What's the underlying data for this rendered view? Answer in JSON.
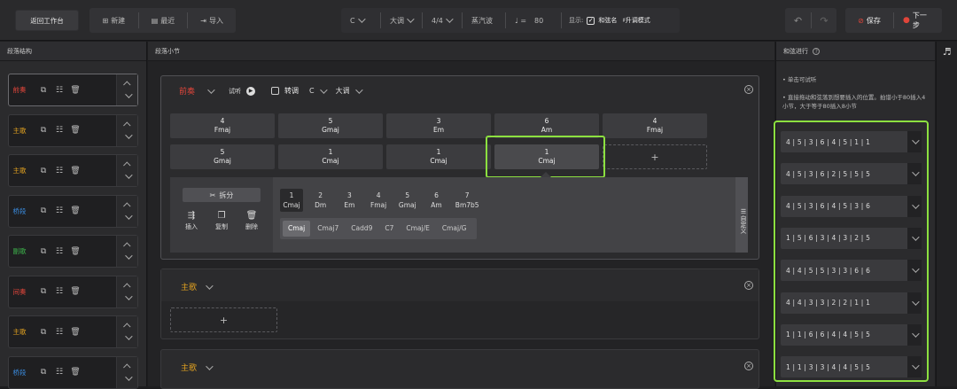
{
  "toolbar": {
    "back_label": "返回工作台",
    "new_label": "新建",
    "recent_label": "最近",
    "import_label": "导入",
    "key": "C",
    "mode": "大调",
    "meter": "4/4",
    "style": "蒸汽波",
    "tempo_symbol": "♩ =",
    "tempo": "80",
    "display_label": "显示:",
    "chord_name_label": "和弦名",
    "sharp_mode_label": "♯升调模式",
    "save_label": "保存",
    "next_label": "下一步"
  },
  "left": {
    "title": "段落结构",
    "sections": [
      {
        "label": "前奏",
        "color": "#e0453a"
      },
      {
        "label": "主歌",
        "color": "#e0a020"
      },
      {
        "label": "主歌",
        "color": "#e0a020"
      },
      {
        "label": "桥段",
        "color": "#3a8ce0"
      },
      {
        "label": "副歌",
        "color": "#3cb24a"
      },
      {
        "label": "间奏",
        "color": "#e0453a"
      },
      {
        "label": "主歌",
        "color": "#e0a020"
      },
      {
        "label": "桥段",
        "color": "#3a8ce0"
      }
    ]
  },
  "center": {
    "title": "段落小节",
    "intro": {
      "name": "前奏",
      "listen_label": "试听",
      "transpose_label": "转调",
      "key": "C",
      "mode": "大调",
      "measures": [
        {
          "n": "4",
          "chord": "Fmaj"
        },
        {
          "n": "5",
          "chord": "Gmaj"
        },
        {
          "n": "3",
          "chord": "Em"
        },
        {
          "n": "6",
          "chord": "Am"
        },
        {
          "n": "4",
          "chord": "Fmaj"
        },
        {
          "n": "5",
          "chord": "Gmaj"
        },
        {
          "n": "1",
          "chord": "Cmaj"
        },
        {
          "n": "1",
          "chord": "Cmaj"
        },
        {
          "n": "1",
          "chord": "Cmaj"
        }
      ],
      "editor": {
        "split_label": "拆分",
        "insert_label": "插入",
        "copy_label": "复制",
        "delete_label": "删除",
        "custom_label": "自定义",
        "chords": [
          {
            "n": "1",
            "name": "Cmaj"
          },
          {
            "n": "2",
            "name": "Dm"
          },
          {
            "n": "3",
            "name": "Em"
          },
          {
            "n": "4",
            "name": "Fmaj"
          },
          {
            "n": "5",
            "name": "Gmaj"
          },
          {
            "n": "6",
            "name": "Am"
          },
          {
            "n": "7",
            "name": "Bm7b5"
          }
        ],
        "variants": [
          "Cmaj",
          "Cmaj7",
          "Cadd9",
          "C7",
          "Cmaj/E",
          "Cmaj/G"
        ]
      }
    },
    "verse1": {
      "name": "主歌"
    },
    "verse2": {
      "name": "主歌"
    }
  },
  "right": {
    "title": "和弦进行",
    "hint1": "• 单击可试听",
    "hint2": "• 直接拖动和弦落到想要插入的位置。拍谱小于80插入4小节，大于等于80插入8小节",
    "progressions": [
      "4 | 5 | 3 | 6 | 4 | 5 | 1 | 1",
      "4 | 5 | 3 | 6 | 2 | 5 | 5 | 5",
      "4 | 5 | 3 | 6 | 4 | 5 | 3 | 6",
      "1 | 5 | 6 | 3 | 4 | 3 | 2 | 5",
      "4 | 4 | 5 | 5 | 3 | 3 | 6 | 6",
      "4 | 4 | 3 | 3 | 2 | 2 | 1 | 1",
      "1 | 1 | 6 | 6 | 4 | 4 | 5 | 5",
      "1 | 1 | 3 | 3 | 4 | 4 | 5 | 5"
    ]
  },
  "colors": {
    "accent_green": "#8ce040",
    "save_red": "#e0453a",
    "intro_red": "#e0453a",
    "verse_orange": "#e0a020"
  }
}
